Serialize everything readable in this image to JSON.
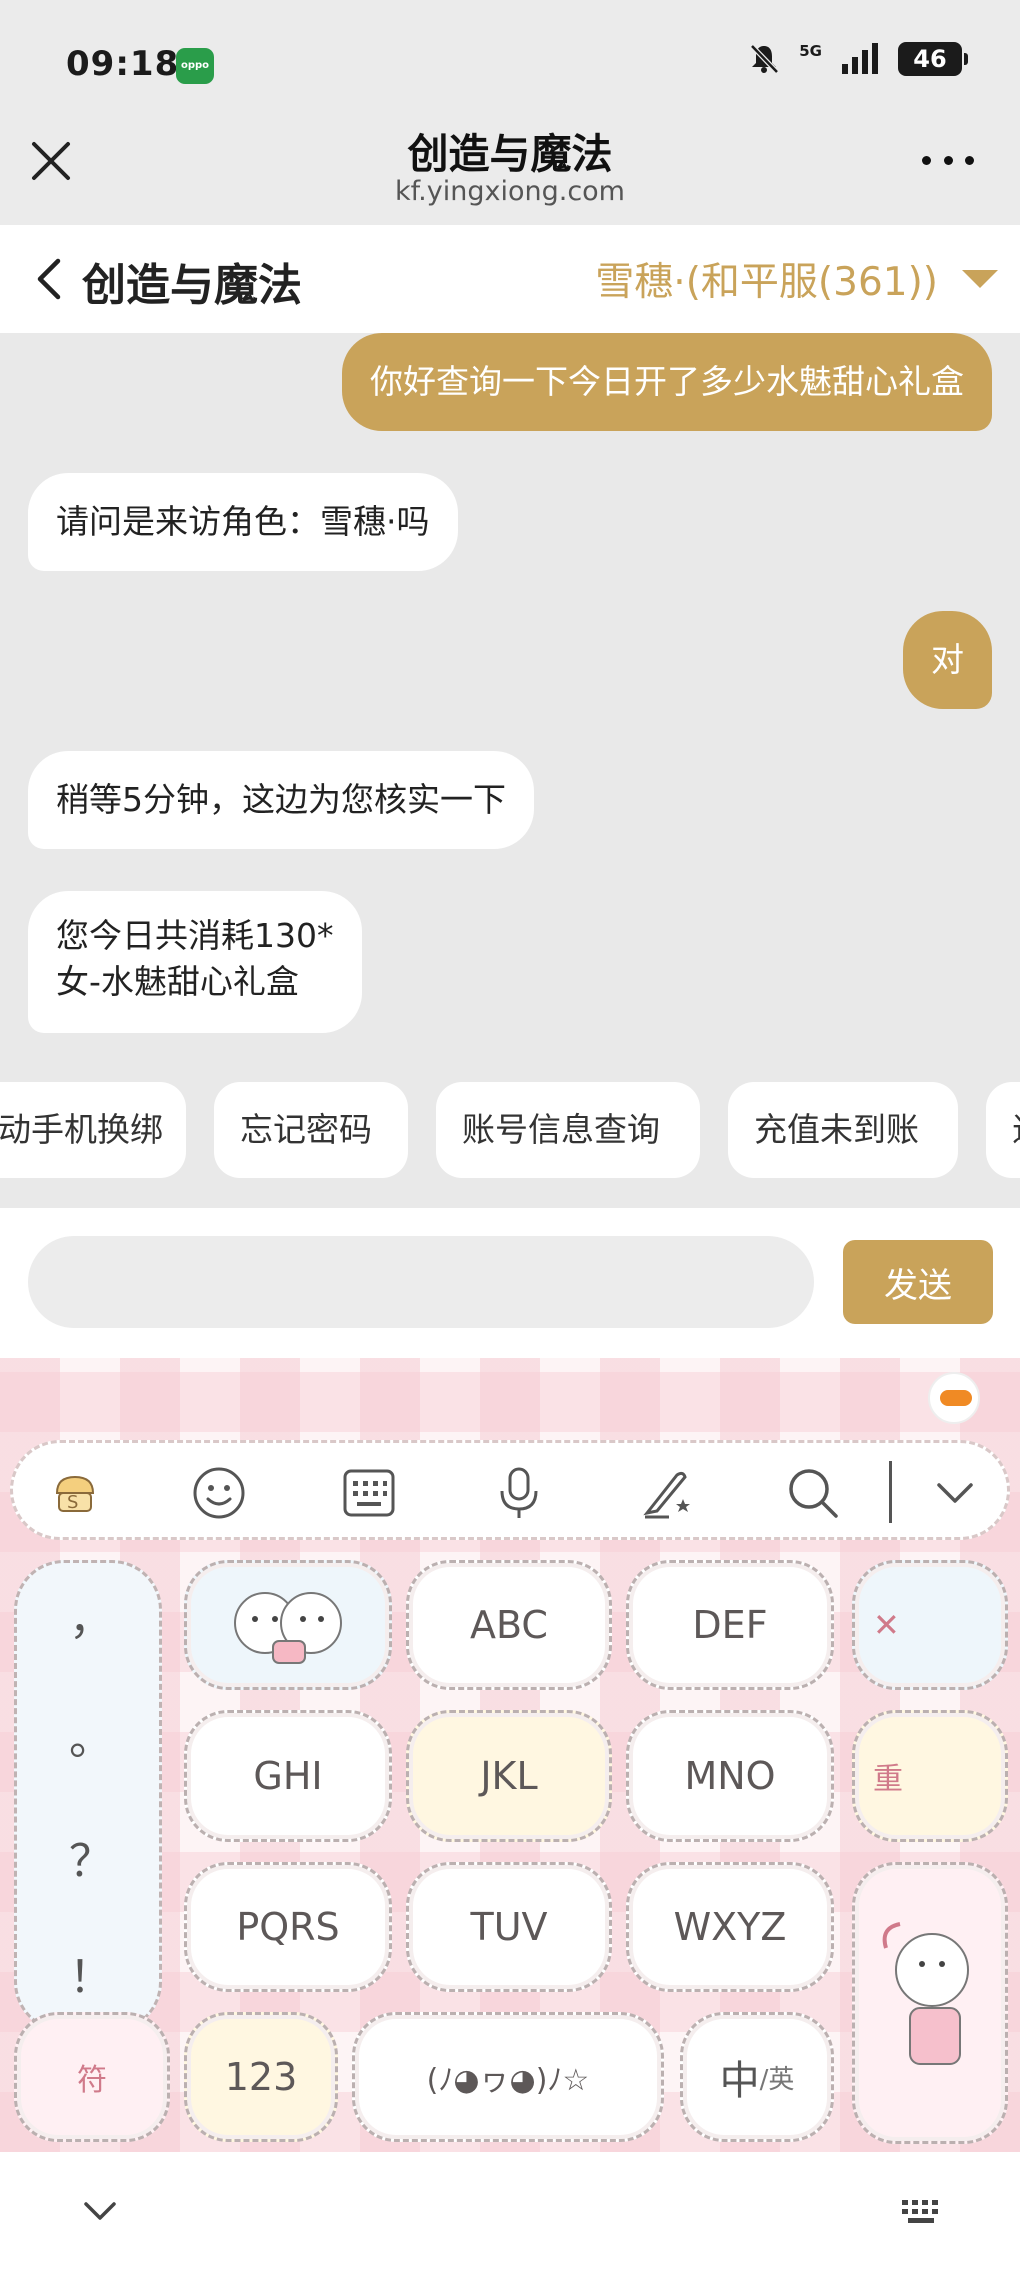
{
  "status_bar": {
    "time": "09:18",
    "app_badge": "oppo",
    "network": "5G",
    "battery": "46"
  },
  "web_header": {
    "title": "创造与魔法",
    "url": "kf.yingxiong.com"
  },
  "page_header": {
    "title": "创造与魔法",
    "role": "雪穗·(和平服(361))"
  },
  "messages": [
    {
      "from": "user",
      "text": "你好查询一下今日开了多少水魅甜心礼盒"
    },
    {
      "from": "agent",
      "text": "请问是来访角色：雪穗·吗"
    },
    {
      "from": "user",
      "text": "对"
    },
    {
      "from": "agent",
      "text": "稍等5分钟，这边为您核实一下"
    },
    {
      "from": "agent",
      "lines": [
        "您今日共消耗130*",
        "女-水魅甜心礼盒"
      ]
    }
  ],
  "quick_replies": [
    "动手机换绑",
    "忘记密码",
    "账号信息查询",
    "充值未到账",
    "退"
  ],
  "input": {
    "value": "",
    "send_label": "发送"
  },
  "keyboard": {
    "toolbar_icons": [
      "sogou-skin-icon",
      "emoji-icon",
      "keyboard-layout-icon",
      "microphone-icon",
      "handwriting-icon",
      "search-icon",
      "collapse-keyboard-icon"
    ],
    "punctuation": [
      "，",
      "。",
      "？",
      "！"
    ],
    "rows": [
      [
        "",
        "ABC",
        "DEF"
      ],
      [
        "GHI",
        "JKL",
        "MNO"
      ],
      [
        "PQRS",
        "TUV",
        "WXYZ"
      ]
    ],
    "delete_label": "✕",
    "reenter_label": "重",
    "symbol_label": "符",
    "num_label": "123",
    "kaomoji_label": "(ﾉ◕ヮ◕)ﾉ☆",
    "lang_label_main": "中",
    "lang_label_sub": "/英",
    "accent_color": "#c9a35a"
  }
}
